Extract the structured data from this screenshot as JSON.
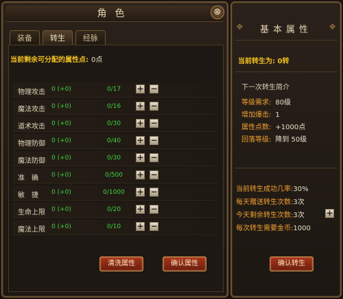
{
  "window": {
    "title": "角色",
    "close_label": "⊗"
  },
  "tabs": [
    {
      "label": "装备"
    },
    {
      "label": "转生"
    },
    {
      "label": "经脉"
    }
  ],
  "points": {
    "label": "当前剩余可分配的属性点:",
    "value": "0点"
  },
  "attributes": [
    {
      "name": "物理攻击",
      "bonus": "0 (+0)",
      "count": "0/17"
    },
    {
      "name": "魔法攻击",
      "bonus": "0 (+0)",
      "count": "0/16"
    },
    {
      "name": "道术攻击",
      "bonus": "0 (+0)",
      "count": "0/30"
    },
    {
      "name": "物理防御",
      "bonus": "0 (+0)",
      "count": "0/40"
    },
    {
      "name": "魔法防御",
      "bonus": "0 (+0)",
      "count": "0/30"
    },
    {
      "name": "准　确",
      "bonus": "0 (+0)",
      "count": "0/500"
    },
    {
      "name": "敏　捷",
      "bonus": "0 (+0)",
      "count": "0/1000"
    },
    {
      "name": "生命上限",
      "bonus": "0 (+0)",
      "count": "0/20"
    },
    {
      "name": "魔法上限",
      "bonus": "0 (+0)",
      "count": "0/10"
    }
  ],
  "buttons": {
    "plus": "+",
    "minus": "−",
    "clear": "清洗属性",
    "confirm_attr": "确认属性",
    "confirm_rebirth": "确认转生"
  },
  "right": {
    "title": "基本属性",
    "current_rebirth": "当前转生为: 0转",
    "next_title": "下一次转生简介",
    "next_items": [
      {
        "label": "等级需求:",
        "value": "80级"
      },
      {
        "label": "增加爆击:",
        "value": "1"
      },
      {
        "label": "属性点数:",
        "value": "+1000点"
      },
      {
        "label": "回落等级:",
        "value": "降到 50级"
      }
    ],
    "stats": [
      {
        "label": "当前转生成功几率:",
        "value": "30%"
      },
      {
        "label": "每天赠送转生次数:",
        "value": "3次"
      },
      {
        "label": "今天剩余转生次数:",
        "value": "3次"
      },
      {
        "label": "每次转生需要金币:",
        "value": "1000"
      }
    ]
  }
}
